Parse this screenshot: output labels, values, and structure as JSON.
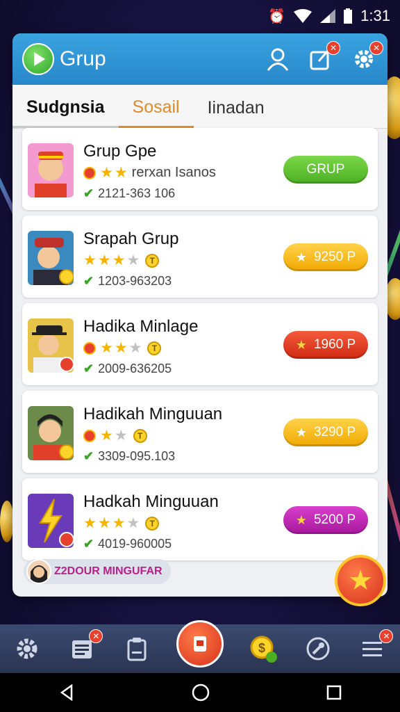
{
  "status_bar": {
    "time": "1:31"
  },
  "app": {
    "title": "Grup"
  },
  "tabs": [
    {
      "label": "Sudgnsia"
    },
    {
      "label": "Sosail"
    },
    {
      "label": "Iinadan"
    }
  ],
  "groups": [
    {
      "name": "Grup Gpe",
      "rating_text": "rerxan Isanos",
      "phone": "2121-363 106",
      "button": {
        "label": "GRUP",
        "color": "#5bbf2a"
      }
    },
    {
      "name": "Srapah Grup",
      "phone": "1203-963203",
      "button": {
        "label": "9250 P",
        "color": "#f5b400"
      }
    },
    {
      "name": "Hadika Minlage",
      "phone": "2009-636205",
      "button": {
        "label": "1960 P",
        "color": "#e23b24"
      }
    },
    {
      "name": "Hadikah Minguuan",
      "phone": "3309-095.103",
      "button": {
        "label": "3290 P",
        "color": "#f5b400"
      }
    },
    {
      "name": "Hadkah Minguuan",
      "phone": "4019-960005",
      "button": {
        "label": "5200 P",
        "color": "#c225b8"
      }
    }
  ],
  "bottom_chip": {
    "label": "Z2DOUR MINGUFAR"
  },
  "icons": {
    "profile": "person-icon",
    "edit": "edit-icon",
    "settings": "gear-icon",
    "fab": "star-icon"
  }
}
